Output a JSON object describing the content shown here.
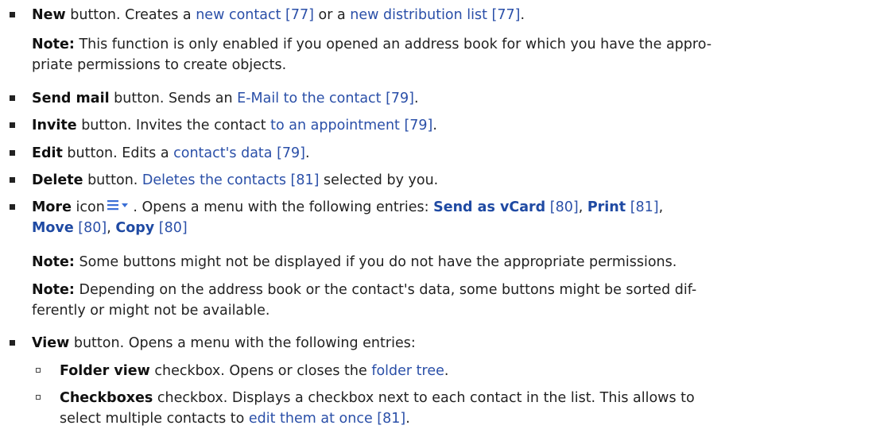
{
  "items": [
    {
      "bold": "New",
      "pre": " button. Creates a ",
      "link1": "new contact [77]",
      "mid": " or a ",
      "link2": "new distribution list [77]",
      "post": "."
    },
    {
      "bold": "Send mail",
      "pre": " button. Sends an ",
      "link": "E-Mail to the contact [79]",
      "post": "."
    },
    {
      "bold": "Invite",
      "pre": " button. Invites the contact ",
      "link": "to an appointment [79]",
      "post": "."
    },
    {
      "bold": "Edit",
      "pre": " button. Edits a ",
      "link": "contact's data [79]",
      "post": "."
    },
    {
      "bold": "Delete",
      "pre": " button. ",
      "link": "Deletes the contacts [81]",
      "post": " selected by you."
    },
    {
      "bold": "More",
      "pre": " icon",
      "post": " . Opens a menu with the following entries: ",
      "entries": [
        {
          "label": "Send as vCard",
          "ref": "[80]"
        },
        {
          "label": "Print",
          "ref": "[81]"
        },
        {
          "label": "Move",
          "ref": "[80]"
        },
        {
          "label": "Copy",
          "ref": "[80]"
        }
      ]
    },
    {
      "bold": "View",
      "pre": " button. Opens a menu with the following entries:"
    }
  ],
  "notes": {
    "note_label": "Note:",
    "n1_line1": " This function is only enabled if you opened an address book for which you have the appro-",
    "n1_line2": "priate permissions to create objects.",
    "n2": " Some buttons might not be displayed if you do not have the appropriate permissions.",
    "n3_line1": " Depending on the address book or the contact's data, some buttons might be sorted dif-",
    "n3_line2": "ferently or might not be available."
  },
  "subitems": [
    {
      "bold": "Folder view",
      "pre": " checkbox. Opens or closes the ",
      "link": "folder tree",
      "post": "."
    },
    {
      "bold": "Checkboxes",
      "line1": " checkbox. Displays a checkbox next to each contact in the list. This allows to",
      "line2_pre": "select multiple contacts to ",
      "link": "edit them at once [81]",
      "post": "."
    }
  ],
  "colors": {
    "link": "#2a4fa8",
    "icon": "#3b6fd6"
  },
  "icons": [
    "menu-lines-icon",
    "dropdown-triangle-icon"
  ]
}
